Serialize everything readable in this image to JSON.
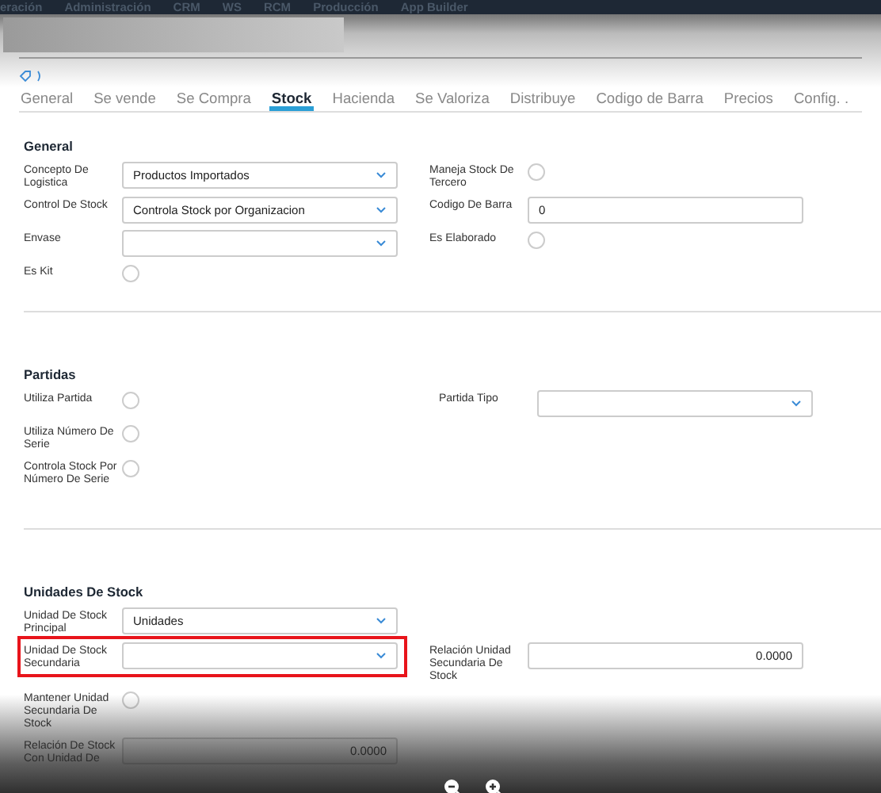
{
  "menu_bar": {
    "items": [
      "eración",
      "Administración",
      "CRM",
      "WS",
      "RCM",
      "Producción",
      "App Builder"
    ]
  },
  "tabs": [
    {
      "label": "General",
      "selected": false
    },
    {
      "label": "Se vende",
      "selected": false
    },
    {
      "label": "Se Compra",
      "selected": false
    },
    {
      "label": "Stock",
      "selected": true
    },
    {
      "label": "Hacienda",
      "selected": false
    },
    {
      "label": "Se Valoriza",
      "selected": false
    },
    {
      "label": "Distribuye",
      "selected": false
    },
    {
      "label": "Codigo de Barra",
      "selected": false
    },
    {
      "label": "Precios",
      "selected": false
    },
    {
      "label": "Config. .",
      "selected": false
    }
  ],
  "sections": [
    {
      "title": "General",
      "rows": [
        {
          "left": {
            "kind": "select",
            "label": "Concepto De Logistica",
            "value": "Productos Importados"
          },
          "right": {
            "kind": "radio",
            "label": "Maneja Stock De Tercero",
            "checked": false
          }
        },
        {
          "left": {
            "kind": "select",
            "label": "Control De Stock",
            "value": "Controla Stock por Organizacion"
          },
          "right": {
            "kind": "text",
            "label": "Codigo De Barra",
            "value": "0"
          }
        },
        {
          "left": {
            "kind": "select",
            "label": "Envase"
          },
          "right": {
            "kind": "radio",
            "label": "Es Elaborado",
            "checked": false
          }
        },
        {
          "left": {
            "kind": "radio",
            "label": "Es Kit",
            "checked": false
          }
        }
      ]
    },
    {
      "title": "Partidas",
      "rows": [
        {
          "left": {
            "kind": "radio",
            "label": "Utiliza Partida",
            "checked": false
          },
          "right": {
            "kind": "select",
            "label": "Partida Tipo"
          }
        },
        {
          "left": {
            "kind": "radio",
            "label": "Utiliza Número De Serie",
            "checked": false
          }
        },
        {
          "left": {
            "kind": "radio",
            "label": "Controla Stock Por Número De Serie",
            "checked": false
          }
        }
      ]
    },
    {
      "title": "Unidades De Stock",
      "rows": [
        {
          "left": {
            "kind": "select",
            "label": "Unidad De Stock Principal",
            "value": "Unidades"
          }
        },
        {
          "left": {
            "kind": "select",
            "label": "Unidad De Stock Secundaria",
            "highlighted": true
          },
          "right": {
            "kind": "number",
            "label": "Relación Unidad Secundaria De Stock",
            "value": "0.0000"
          }
        },
        {
          "left": {
            "kind": "radio",
            "label": "Mantener Unidad Secundaria De Stock",
            "checked": false
          }
        },
        {
          "left": {
            "kind": "number",
            "label": "Relación De Stock Con Unidad De",
            "value": "0.0000",
            "disabled": true
          }
        }
      ]
    }
  ]
}
